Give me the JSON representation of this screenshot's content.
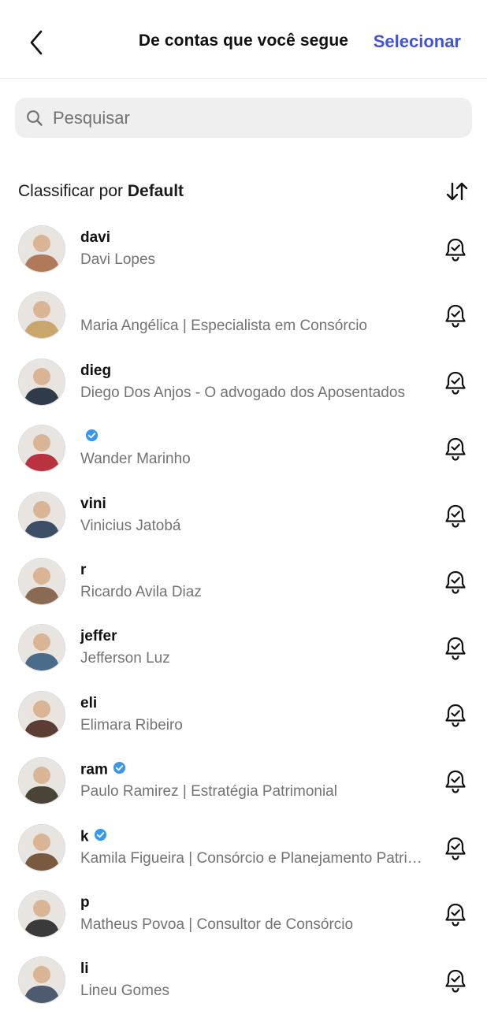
{
  "header": {
    "title": "De contas que você segue",
    "select_label": "Selecionar",
    "back_icon": "chevron-left-icon"
  },
  "search": {
    "placeholder": "Pesquisar",
    "value": "",
    "icon": "search-icon"
  },
  "sort": {
    "prefix": "Classificar por ",
    "value": "Default",
    "icon": "sort-arrows-icon"
  },
  "colors": {
    "accent": "#4153d6",
    "secondary_text": "#737373",
    "search_bg": "#efefef",
    "verified": "#3897f0"
  },
  "accounts": [
    {
      "username": "davi",
      "full_name": "Davi Lopes",
      "verified": false,
      "avatar_color": "#b07a5a"
    },
    {
      "username": "",
      "full_name": "Maria Angélica | Especialista em Consórcio",
      "verified": false,
      "avatar_color": "#c9a66b"
    },
    {
      "username": "dieg",
      "full_name": "Diego Dos Anjos - O advogado dos Aposentados",
      "verified": false,
      "avatar_color": "#2f3a4a"
    },
    {
      "username": "",
      "full_name": "Wander Marinho",
      "verified": true,
      "avatar_color": "#b8333f"
    },
    {
      "username": "vini",
      "full_name": "Vinicius Jatobá",
      "verified": false,
      "avatar_color": "#3c4e66"
    },
    {
      "username": "r",
      "full_name": "Ricardo Avila Diaz",
      "verified": false,
      "avatar_color": "#8a6a52"
    },
    {
      "username": "jeffer",
      "full_name": "Jefferson Luz",
      "verified": false,
      "avatar_color": "#4a6b8a"
    },
    {
      "username": "eli",
      "full_name": "Elimara Ribeiro",
      "verified": false,
      "avatar_color": "#5c3d33"
    },
    {
      "username": "ram",
      "full_name": "Paulo Ramirez | Estratégia Patrimonial",
      "verified": true,
      "avatar_color": "#4a4438"
    },
    {
      "username": "k",
      "full_name": "Kamila Figueira | Consórcio e Planejamento Patrimonial",
      "verified": true,
      "avatar_color": "#7a5a3e"
    },
    {
      "username": "p",
      "full_name": "Matheus Povoa | Consultor de Consórcio",
      "verified": false,
      "avatar_color": "#3a3a3a"
    },
    {
      "username": "li",
      "full_name": "Lineu Gomes",
      "verified": false,
      "avatar_color": "#4d5a70"
    }
  ],
  "row_icon": "bell-icon"
}
